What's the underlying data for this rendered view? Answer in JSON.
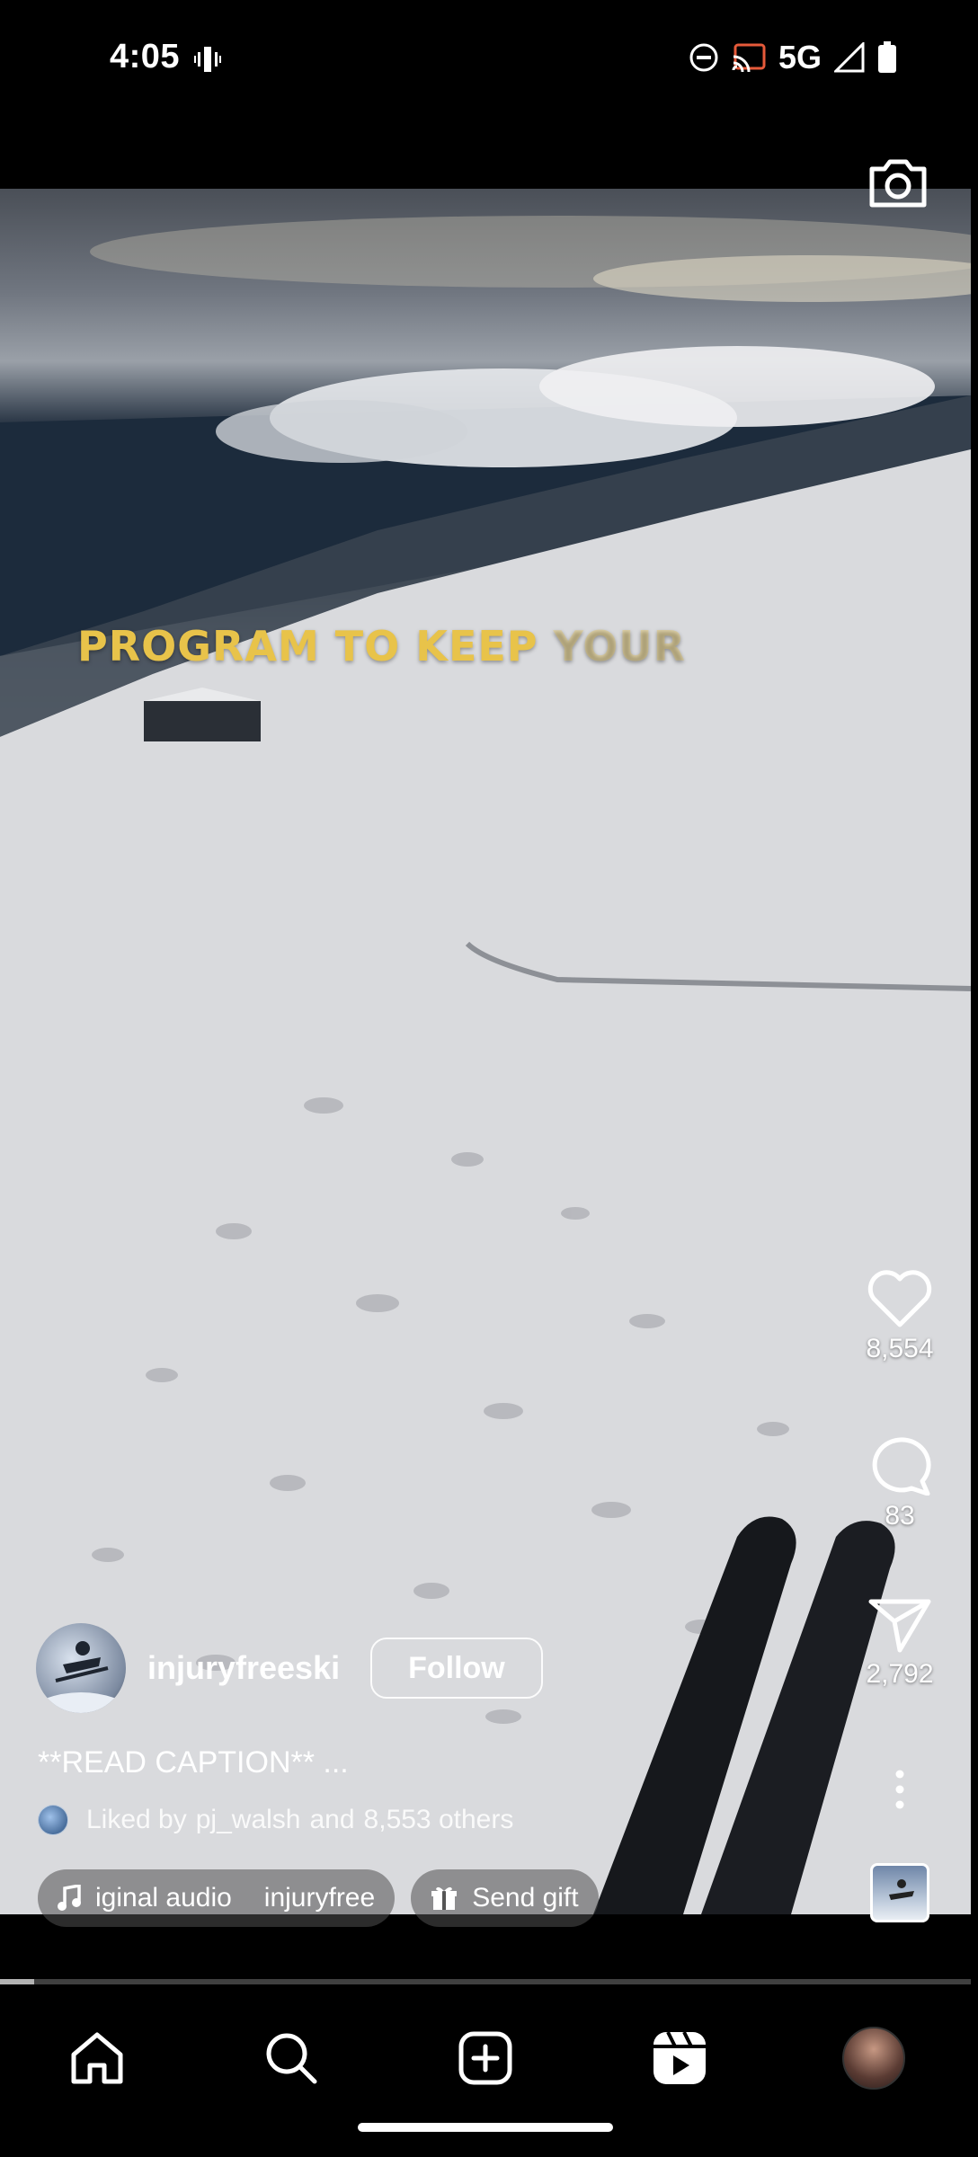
{
  "status_bar": {
    "time": "4:05",
    "network": "5G",
    "icons": [
      "vibrate-icon",
      "do-not-disturb-icon",
      "cast-icon",
      "signal-icon",
      "battery-icon"
    ]
  },
  "video": {
    "overlay_text": "PROGRAM TO KEEP",
    "overlay_text_faded": "YOUR",
    "overlay_color": "#e8c34a"
  },
  "actions": {
    "likes": "8,554",
    "comments": "83",
    "shares": "2,792"
  },
  "post": {
    "username": "injuryfreeski",
    "follow_label": "Follow",
    "caption": "**READ CAPTION** ...",
    "liked_prefix": "Liked by",
    "liked_user": "pj_walsh",
    "liked_and": "and",
    "liked_others": "8,553 others",
    "audio_label": "iginal audio",
    "audio_author": "injuryfree",
    "gift_label": "Send gift"
  },
  "progress": {
    "fraction": 0.035
  },
  "nav": {
    "items": [
      "home-icon",
      "search-icon",
      "create-icon",
      "reels-icon",
      "profile-avatar"
    ]
  }
}
